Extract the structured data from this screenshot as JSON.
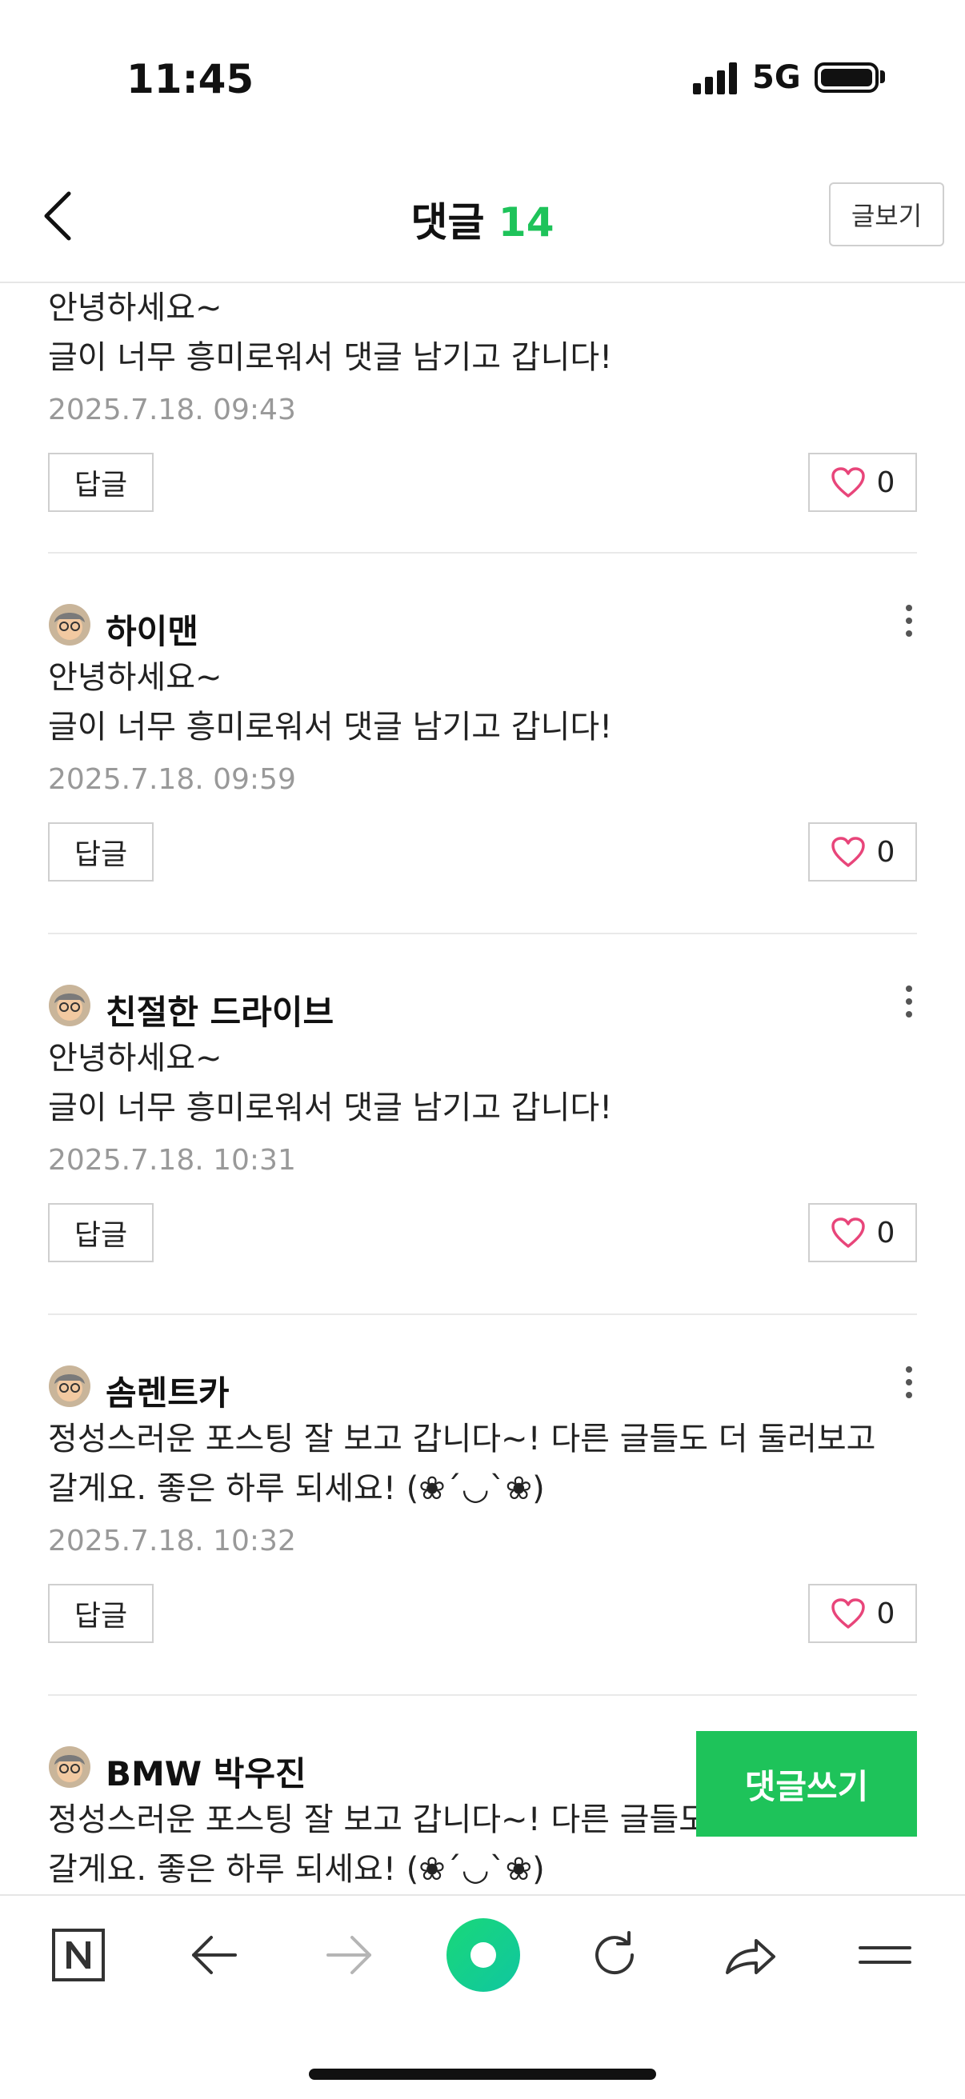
{
  "status_bar": {
    "time": "11:45",
    "network": "5G"
  },
  "header": {
    "title": "댓글",
    "count": "14",
    "view_post_label": "글보기"
  },
  "comments": [
    {
      "author": "",
      "text": "안녕하세요~\n글이 너무 흥미로워서 댓글 남기고 갑니다!",
      "date": "2025.7.18. 09:43",
      "likes": "0"
    },
    {
      "author": "하이맨",
      "text": "안녕하세요~\n글이 너무 흥미로워서 댓글 남기고 갑니다!",
      "date": "2025.7.18. 09:59",
      "likes": "0"
    },
    {
      "author": "친절한 드라이브",
      "text": "안녕하세요~\n글이 너무 흥미로워서 댓글 남기고 갑니다!",
      "date": "2025.7.18. 10:31",
      "likes": "0"
    },
    {
      "author": "솜렌트카",
      "text": "정성스러운 포스팅 잘 보고 갑니다~! 다른 글들도 더 둘러보고\n갈게요. 좋은 하루 되세요! (❀´◡`❀)",
      "date": "2025.7.18. 10:32",
      "likes": "0"
    },
    {
      "author": "BMW 박우진",
      "text": "정성스러운 포스팅 잘 보고 갑니다~! 다른 글들도 더 둘러보고\n갈게요. 좋은 하루 되세요! (❀´◡`❀)",
      "date": "",
      "likes": ""
    }
  ],
  "reply_label": "답글",
  "write_comment_label": "댓글쓰기",
  "toolbar": {
    "icons": [
      "naver-n-icon",
      "back-arrow-icon",
      "forward-arrow-icon",
      "green-dot-icon",
      "refresh-icon",
      "share-icon",
      "menu-icon"
    ]
  },
  "colors": {
    "accent": "#1ec35a",
    "heart": "#e8457a",
    "date": "#999999"
  }
}
